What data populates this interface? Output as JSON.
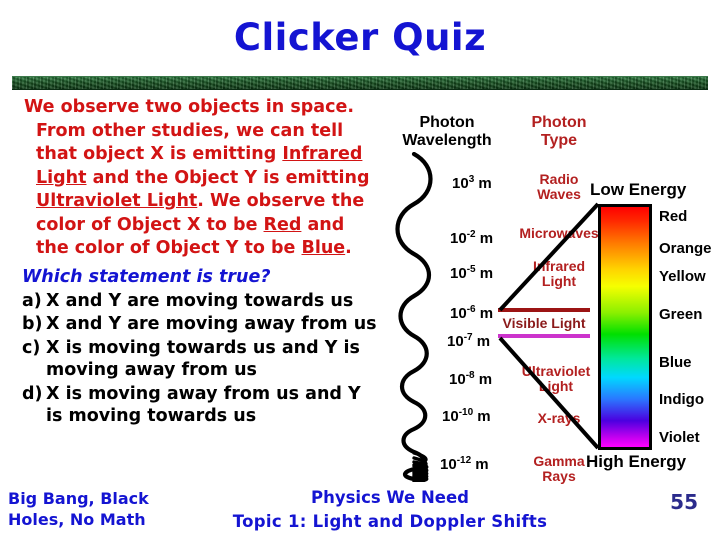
{
  "slide": {
    "title": "Clicker Quiz",
    "number": "55",
    "title_color": "#1414d2",
    "divider_color": "#1d5c2c"
  },
  "question": {
    "prompt_parts": {
      "p1": "We observe two objects in space. From other studies, we can tell that object X is emitting ",
      "term_infrared": "Infrared Light",
      "p2": " and the Object Y is emitting ",
      "term_ultraviolet": "Ultraviolet Light",
      "p3": ". We observe the color of Object X to be ",
      "term_red": "Red",
      "p4": " and the color of Object Y to be ",
      "term_blue": "Blue",
      "p5": "."
    },
    "prompt_color": "#d21414",
    "stem": "Which statement is true?",
    "stem_color": "#1414d2",
    "options": [
      {
        "letter": "a)",
        "text": "X and Y are moving towards us"
      },
      {
        "letter": "b)",
        "text": "X and Y are moving away from us"
      },
      {
        "letter": "c)",
        "text": "X is moving towards us and Y is moving away from us"
      },
      {
        "letter": "d)",
        "text": "X is moving away from us and Y is moving towards us"
      }
    ]
  },
  "spectrum": {
    "headings": {
      "wavelength": "Photon Wavelength",
      "wavelength_line1": "Photon",
      "wavelength_line2": "Wavelength",
      "photon_type": "Photon Type",
      "photon_type_line1": "Photon",
      "photon_type_line2": "Type"
    },
    "wavelengths": [
      {
        "mantissa": "10",
        "exponent": "3",
        "unit": " m"
      },
      {
        "mantissa": "10",
        "exponent": "-2",
        "unit": " m"
      },
      {
        "mantissa": "10",
        "exponent": "-5",
        "unit": " m"
      },
      {
        "mantissa": "10",
        "exponent": "-6",
        "unit": " m"
      },
      {
        "mantissa": "10",
        "exponent": "-7",
        "unit": " m"
      },
      {
        "mantissa": "10",
        "exponent": "-8",
        "unit": " m"
      },
      {
        "mantissa": "10",
        "exponent": "-10",
        "unit": " m"
      },
      {
        "mantissa": "10",
        "exponent": "-12",
        "unit": " m"
      }
    ],
    "photon_types": [
      {
        "line1": "Radio",
        "line2": "Waves"
      },
      {
        "line1": "Microwaves",
        "line2": ""
      },
      {
        "line1": "Infrared",
        "line2": "Light"
      },
      {
        "line1": "Visible Light",
        "line2": ""
      },
      {
        "line1": "Ultraviolet",
        "line2": "Light"
      },
      {
        "line1": "X-rays",
        "line2": ""
      },
      {
        "line1": "Gamma",
        "line2": "Rays"
      }
    ],
    "energy_low": "Low Energy",
    "energy_high": "High Energy",
    "colors": [
      "Red",
      "Orange",
      "Yellow",
      "Green",
      "Blue",
      "Indigo",
      "Violet"
    ],
    "marker_top_color": "#9c1414",
    "marker_bottom_color": "#cc33cc"
  },
  "footer": {
    "left_line1": "Big Bang, Black",
    "left_line2": "Holes, No Math",
    "center_line1": "Physics We Need",
    "center_line2": "Topic 1: Light and Doppler Shifts"
  }
}
